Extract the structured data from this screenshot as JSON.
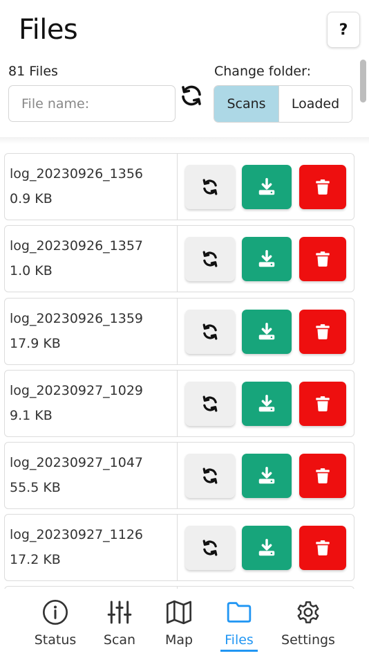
{
  "header": {
    "title": "Files",
    "help_label": "?",
    "file_count": "81 Files",
    "search_placeholder": "File name:",
    "change_folder_label": "Change folder:",
    "folders": [
      {
        "label": "Scans",
        "active": true
      },
      {
        "label": "Loaded",
        "active": false
      }
    ]
  },
  "colors": {
    "active_folder": "#add8e6",
    "download": "#17a57b",
    "delete": "#ee0f0f",
    "reload": "#efefef",
    "nav_active": "#2196f3"
  },
  "files": [
    {
      "name": "log_20230926_1356",
      "size": "0.9 KB"
    },
    {
      "name": "log_20230926_1357",
      "size": "1.0 KB"
    },
    {
      "name": "log_20230926_1359",
      "size": "17.9 KB"
    },
    {
      "name": "log_20230927_1029",
      "size": "9.1 KB"
    },
    {
      "name": "log_20230927_1047",
      "size": "55.5 KB"
    },
    {
      "name": "log_20230927_1126",
      "size": "17.2 KB"
    }
  ],
  "nav": [
    {
      "label": "Status",
      "icon": "info-icon",
      "active": false
    },
    {
      "label": "Scan",
      "icon": "sliders-icon",
      "active": false
    },
    {
      "label": "Map",
      "icon": "map-icon",
      "active": false
    },
    {
      "label": "Files",
      "icon": "folder-icon",
      "active": true
    },
    {
      "label": "Settings",
      "icon": "gear-icon",
      "active": false
    }
  ]
}
